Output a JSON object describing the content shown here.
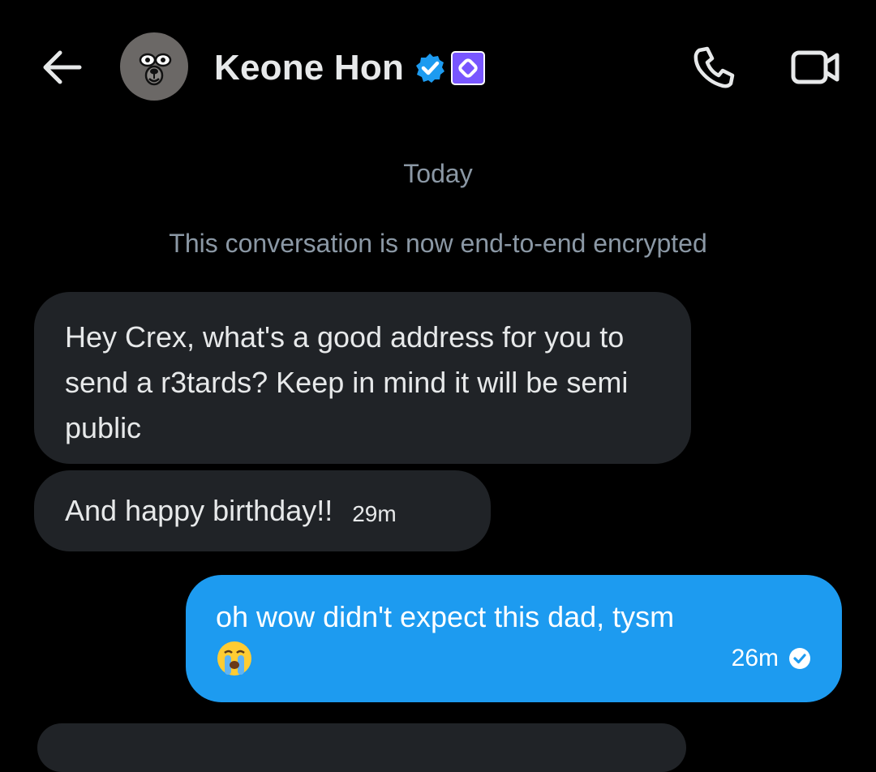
{
  "header": {
    "back_icon": "arrow-left-icon",
    "title": "Keone Hon",
    "verified_icon": "verified-badge-icon",
    "affiliate_icon": "affiliate-badge-icon",
    "call_icon": "phone-icon",
    "video_icon": "video-camera-icon",
    "avatar": "bear-avatar"
  },
  "conversation": {
    "date_label": "Today",
    "encryption_notice": "This conversation is now end-to-end encrypted",
    "messages": [
      {
        "direction": "received",
        "text": "Hey Crex, what's a good address for you to send a r3tards? Keep in mind it will be semi public"
      },
      {
        "direction": "received",
        "text": "And happy birthday!!",
        "time": "29m"
      },
      {
        "direction": "sent",
        "text": "oh wow didn't expect this dad, tysm",
        "emoji": "loudly-crying-face",
        "time": "26m",
        "status_icon": "sent-check-icon"
      }
    ]
  },
  "colors": {
    "background": "#000000",
    "received_bubble": "#202327",
    "sent_bubble": "#1d9bf0",
    "muted_text": "#8b98a5",
    "verified_blue": "#1d9bf0",
    "affiliate_purple": "#7856ff"
  }
}
